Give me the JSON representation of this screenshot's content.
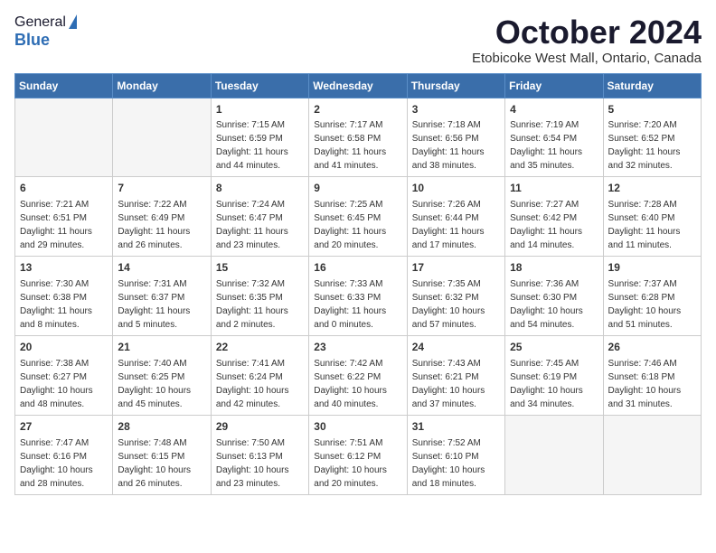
{
  "header": {
    "logo_general": "General",
    "logo_blue": "Blue",
    "month_title": "October 2024",
    "location": "Etobicoke West Mall, Ontario, Canada"
  },
  "weekdays": [
    "Sunday",
    "Monday",
    "Tuesday",
    "Wednesday",
    "Thursday",
    "Friday",
    "Saturday"
  ],
  "weeks": [
    [
      {
        "day": "",
        "sunrise": "",
        "sunset": "",
        "daylight": "",
        "empty": true
      },
      {
        "day": "",
        "sunrise": "",
        "sunset": "",
        "daylight": "",
        "empty": true
      },
      {
        "day": "1",
        "sunrise": "Sunrise: 7:15 AM",
        "sunset": "Sunset: 6:59 PM",
        "daylight": "Daylight: 11 hours and 44 minutes.",
        "empty": false
      },
      {
        "day": "2",
        "sunrise": "Sunrise: 7:17 AM",
        "sunset": "Sunset: 6:58 PM",
        "daylight": "Daylight: 11 hours and 41 minutes.",
        "empty": false
      },
      {
        "day": "3",
        "sunrise": "Sunrise: 7:18 AM",
        "sunset": "Sunset: 6:56 PM",
        "daylight": "Daylight: 11 hours and 38 minutes.",
        "empty": false
      },
      {
        "day": "4",
        "sunrise": "Sunrise: 7:19 AM",
        "sunset": "Sunset: 6:54 PM",
        "daylight": "Daylight: 11 hours and 35 minutes.",
        "empty": false
      },
      {
        "day": "5",
        "sunrise": "Sunrise: 7:20 AM",
        "sunset": "Sunset: 6:52 PM",
        "daylight": "Daylight: 11 hours and 32 minutes.",
        "empty": false
      }
    ],
    [
      {
        "day": "6",
        "sunrise": "Sunrise: 7:21 AM",
        "sunset": "Sunset: 6:51 PM",
        "daylight": "Daylight: 11 hours and 29 minutes.",
        "empty": false
      },
      {
        "day": "7",
        "sunrise": "Sunrise: 7:22 AM",
        "sunset": "Sunset: 6:49 PM",
        "daylight": "Daylight: 11 hours and 26 minutes.",
        "empty": false
      },
      {
        "day": "8",
        "sunrise": "Sunrise: 7:24 AM",
        "sunset": "Sunset: 6:47 PM",
        "daylight": "Daylight: 11 hours and 23 minutes.",
        "empty": false
      },
      {
        "day": "9",
        "sunrise": "Sunrise: 7:25 AM",
        "sunset": "Sunset: 6:45 PM",
        "daylight": "Daylight: 11 hours and 20 minutes.",
        "empty": false
      },
      {
        "day": "10",
        "sunrise": "Sunrise: 7:26 AM",
        "sunset": "Sunset: 6:44 PM",
        "daylight": "Daylight: 11 hours and 17 minutes.",
        "empty": false
      },
      {
        "day": "11",
        "sunrise": "Sunrise: 7:27 AM",
        "sunset": "Sunset: 6:42 PM",
        "daylight": "Daylight: 11 hours and 14 minutes.",
        "empty": false
      },
      {
        "day": "12",
        "sunrise": "Sunrise: 7:28 AM",
        "sunset": "Sunset: 6:40 PM",
        "daylight": "Daylight: 11 hours and 11 minutes.",
        "empty": false
      }
    ],
    [
      {
        "day": "13",
        "sunrise": "Sunrise: 7:30 AM",
        "sunset": "Sunset: 6:38 PM",
        "daylight": "Daylight: 11 hours and 8 minutes.",
        "empty": false
      },
      {
        "day": "14",
        "sunrise": "Sunrise: 7:31 AM",
        "sunset": "Sunset: 6:37 PM",
        "daylight": "Daylight: 11 hours and 5 minutes.",
        "empty": false
      },
      {
        "day": "15",
        "sunrise": "Sunrise: 7:32 AM",
        "sunset": "Sunset: 6:35 PM",
        "daylight": "Daylight: 11 hours and 2 minutes.",
        "empty": false
      },
      {
        "day": "16",
        "sunrise": "Sunrise: 7:33 AM",
        "sunset": "Sunset: 6:33 PM",
        "daylight": "Daylight: 11 hours and 0 minutes.",
        "empty": false
      },
      {
        "day": "17",
        "sunrise": "Sunrise: 7:35 AM",
        "sunset": "Sunset: 6:32 PM",
        "daylight": "Daylight: 10 hours and 57 minutes.",
        "empty": false
      },
      {
        "day": "18",
        "sunrise": "Sunrise: 7:36 AM",
        "sunset": "Sunset: 6:30 PM",
        "daylight": "Daylight: 10 hours and 54 minutes.",
        "empty": false
      },
      {
        "day": "19",
        "sunrise": "Sunrise: 7:37 AM",
        "sunset": "Sunset: 6:28 PM",
        "daylight": "Daylight: 10 hours and 51 minutes.",
        "empty": false
      }
    ],
    [
      {
        "day": "20",
        "sunrise": "Sunrise: 7:38 AM",
        "sunset": "Sunset: 6:27 PM",
        "daylight": "Daylight: 10 hours and 48 minutes.",
        "empty": false
      },
      {
        "day": "21",
        "sunrise": "Sunrise: 7:40 AM",
        "sunset": "Sunset: 6:25 PM",
        "daylight": "Daylight: 10 hours and 45 minutes.",
        "empty": false
      },
      {
        "day": "22",
        "sunrise": "Sunrise: 7:41 AM",
        "sunset": "Sunset: 6:24 PM",
        "daylight": "Daylight: 10 hours and 42 minutes.",
        "empty": false
      },
      {
        "day": "23",
        "sunrise": "Sunrise: 7:42 AM",
        "sunset": "Sunset: 6:22 PM",
        "daylight": "Daylight: 10 hours and 40 minutes.",
        "empty": false
      },
      {
        "day": "24",
        "sunrise": "Sunrise: 7:43 AM",
        "sunset": "Sunset: 6:21 PM",
        "daylight": "Daylight: 10 hours and 37 minutes.",
        "empty": false
      },
      {
        "day": "25",
        "sunrise": "Sunrise: 7:45 AM",
        "sunset": "Sunset: 6:19 PM",
        "daylight": "Daylight: 10 hours and 34 minutes.",
        "empty": false
      },
      {
        "day": "26",
        "sunrise": "Sunrise: 7:46 AM",
        "sunset": "Sunset: 6:18 PM",
        "daylight": "Daylight: 10 hours and 31 minutes.",
        "empty": false
      }
    ],
    [
      {
        "day": "27",
        "sunrise": "Sunrise: 7:47 AM",
        "sunset": "Sunset: 6:16 PM",
        "daylight": "Daylight: 10 hours and 28 minutes.",
        "empty": false
      },
      {
        "day": "28",
        "sunrise": "Sunrise: 7:48 AM",
        "sunset": "Sunset: 6:15 PM",
        "daylight": "Daylight: 10 hours and 26 minutes.",
        "empty": false
      },
      {
        "day": "29",
        "sunrise": "Sunrise: 7:50 AM",
        "sunset": "Sunset: 6:13 PM",
        "daylight": "Daylight: 10 hours and 23 minutes.",
        "empty": false
      },
      {
        "day": "30",
        "sunrise": "Sunrise: 7:51 AM",
        "sunset": "Sunset: 6:12 PM",
        "daylight": "Daylight: 10 hours and 20 minutes.",
        "empty": false
      },
      {
        "day": "31",
        "sunrise": "Sunrise: 7:52 AM",
        "sunset": "Sunset: 6:10 PM",
        "daylight": "Daylight: 10 hours and 18 minutes.",
        "empty": false
      },
      {
        "day": "",
        "sunrise": "",
        "sunset": "",
        "daylight": "",
        "empty": true
      },
      {
        "day": "",
        "sunrise": "",
        "sunset": "",
        "daylight": "",
        "empty": true
      }
    ]
  ]
}
